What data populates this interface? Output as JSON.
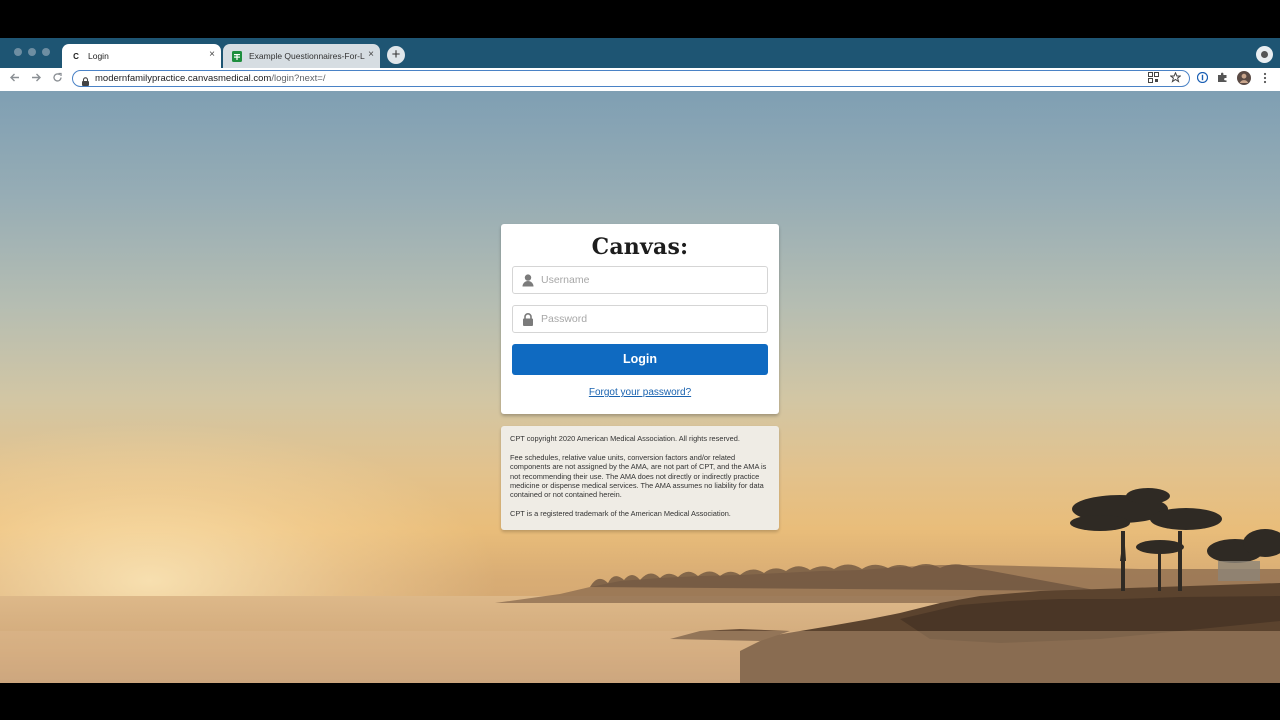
{
  "browser": {
    "tabs": [
      {
        "title": "Login",
        "favicon": "C",
        "active": true
      },
      {
        "title": "Example Questionnaires-For-L",
        "favicon": "sheets-icon",
        "active": false
      }
    ],
    "new_tab_label": "+",
    "close_glyph": "×",
    "url_host": "modernfamilypractice.canvasmedical.com",
    "url_path": "/login?next=/",
    "colors": {
      "tabbar": "#1e5573",
      "accent": "#0f6ac1"
    }
  },
  "login": {
    "logo": "Canvas:",
    "username_placeholder": "Username",
    "password_placeholder": "Password",
    "login_label": "Login",
    "forgot_label": "Forgot your password?"
  },
  "notice": {
    "copyright": "CPT copyright 2020 American Medical Association. All rights reserved.",
    "fee_schedules": "Fee schedules, relative value units, conversion factors and/or related components are not assigned by the AMA, are not part of CPT, and the AMA is not recommending their use. The AMA does not directly or indirectly practice medicine or dispense medical services. The AMA assumes no liability for data contained or not contained herein.",
    "trademark": "CPT is a registered trademark of the American Medical Association."
  }
}
